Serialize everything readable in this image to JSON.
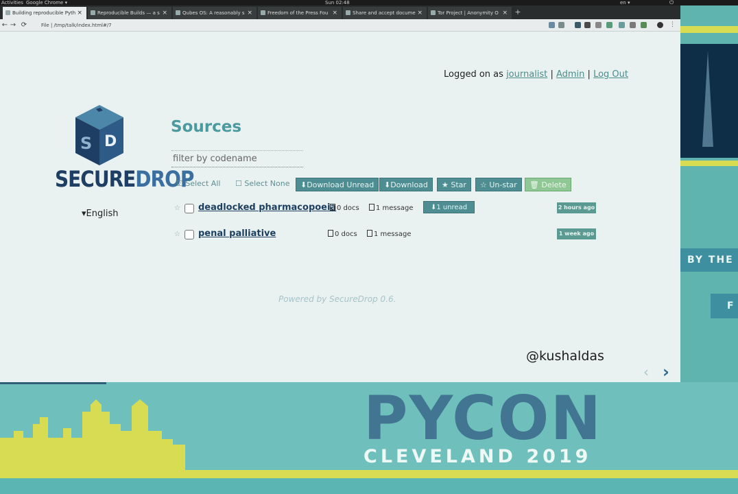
{
  "system_bar": {
    "activities": "Activities",
    "app_menu": "Google Chrome ▾",
    "clock": "Sun 02:48",
    "language": "en ▾",
    "power": "⏻"
  },
  "browser": {
    "tabs": [
      {
        "label": "Building reproducible Pyth",
        "active": true
      },
      {
        "label": "Reproducible Builds — a s",
        "active": false
      },
      {
        "label": "Qubes OS: A reasonably s",
        "active": false
      },
      {
        "label": "Freedom of the Press Fou",
        "active": false
      },
      {
        "label": "Share and accept docume",
        "active": false
      },
      {
        "label": "Tor Project | Anonymity O",
        "active": false
      }
    ],
    "address": "File | /tmp/talk/index.html#/7",
    "back": "←",
    "forward": "→",
    "reload": "⟳"
  },
  "header": {
    "logged_in_prefix": "Logged on as",
    "username": "journalist",
    "admin_link": "Admin",
    "logout_link": "Log Out",
    "sep1": "|",
    "sep2": "|"
  },
  "logo": {
    "secure": "SECURE",
    "drop": "DROP"
  },
  "language_select": "▾English",
  "main": {
    "title": "Sources",
    "filter_placeholder": "filter by codename",
    "select_all": "☑ Select All",
    "select_none": "☐ Select None",
    "buttons": {
      "download_unread": "⬇Download Unread",
      "download": "⬇Download",
      "star": "★ Star",
      "unstar": "☆ Un-star",
      "delete": "🗑 Delete"
    },
    "sources": [
      {
        "codename": "deadlocked pharmacopoeia",
        "docs": "0 docs",
        "messages": "1 message",
        "unread": "⬇1 unread",
        "age": "2 hours ago"
      },
      {
        "codename": "penal palliative",
        "docs": "0 docs",
        "messages": "1 message",
        "unread": "",
        "age": "1 week ago"
      }
    ],
    "powered_by": "Powered by SecureDrop 0.6."
  },
  "slide": {
    "twitter": "@kushaldas",
    "prev": "‹",
    "next": "›",
    "right_band": "BY THE",
    "right_tag": "F",
    "pycon": "PYCON",
    "cleveland": "CLEVELAND 2019"
  },
  "colors": {
    "accent": "#4a9a9f",
    "button": "#4e8e93",
    "delete_button": "#8fc795",
    "brand_dark": "#1f3e63",
    "slide_teal": "#6fc0bd",
    "slide_yellow": "#d8dc52"
  }
}
